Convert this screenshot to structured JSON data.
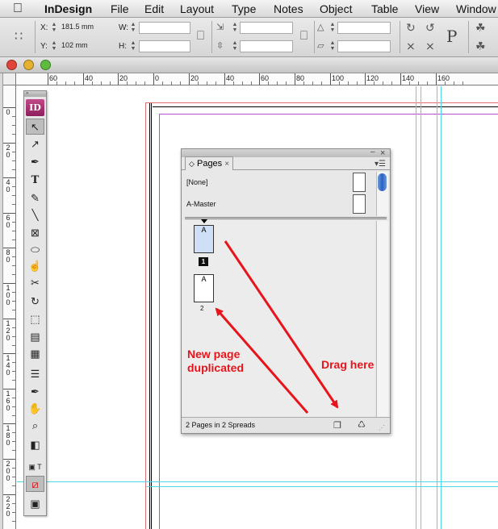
{
  "menubar": {
    "app_name": "InDesign",
    "items": [
      "File",
      "Edit",
      "Layout",
      "Type",
      "Notes",
      "Object",
      "Table",
      "View",
      "Window"
    ]
  },
  "control_panel": {
    "x_label": "X:",
    "x_value": "181.5 mm",
    "y_label": "Y:",
    "y_value": "102 mm",
    "w_label": "W:",
    "h_label": "H:",
    "w_value": "",
    "h_value": ""
  },
  "rulers": {
    "horizontal_labels": [
      "60",
      "40",
      "20",
      "0",
      "20",
      "40",
      "60",
      "80",
      "100",
      "120",
      "140",
      "160"
    ],
    "vertical_labels": [
      "0",
      "20",
      "40",
      "60",
      "80",
      "100",
      "120",
      "140",
      "160",
      "180",
      "200",
      "220"
    ]
  },
  "tools": {
    "logo": "ID"
  },
  "pages_panel": {
    "tab_label": "Pages",
    "masters": [
      "[None]",
      "A-Master"
    ],
    "pages": [
      {
        "letter": "A",
        "number": "1",
        "selected": true
      },
      {
        "letter": "A",
        "number": "2",
        "selected": false
      }
    ],
    "status": "2 Pages in 2 Spreads"
  },
  "annotations": {
    "new_page_line1": "New page",
    "new_page_line2": "duplicated",
    "drag_here": "Drag here"
  },
  "colors": {
    "annotation_red": "#e8141b",
    "guide_cyan": "#4fd8e8",
    "margin_purple": "#b64fd0",
    "indesign_brand": "#a8326f",
    "selected_page": "#cfe0f6"
  }
}
